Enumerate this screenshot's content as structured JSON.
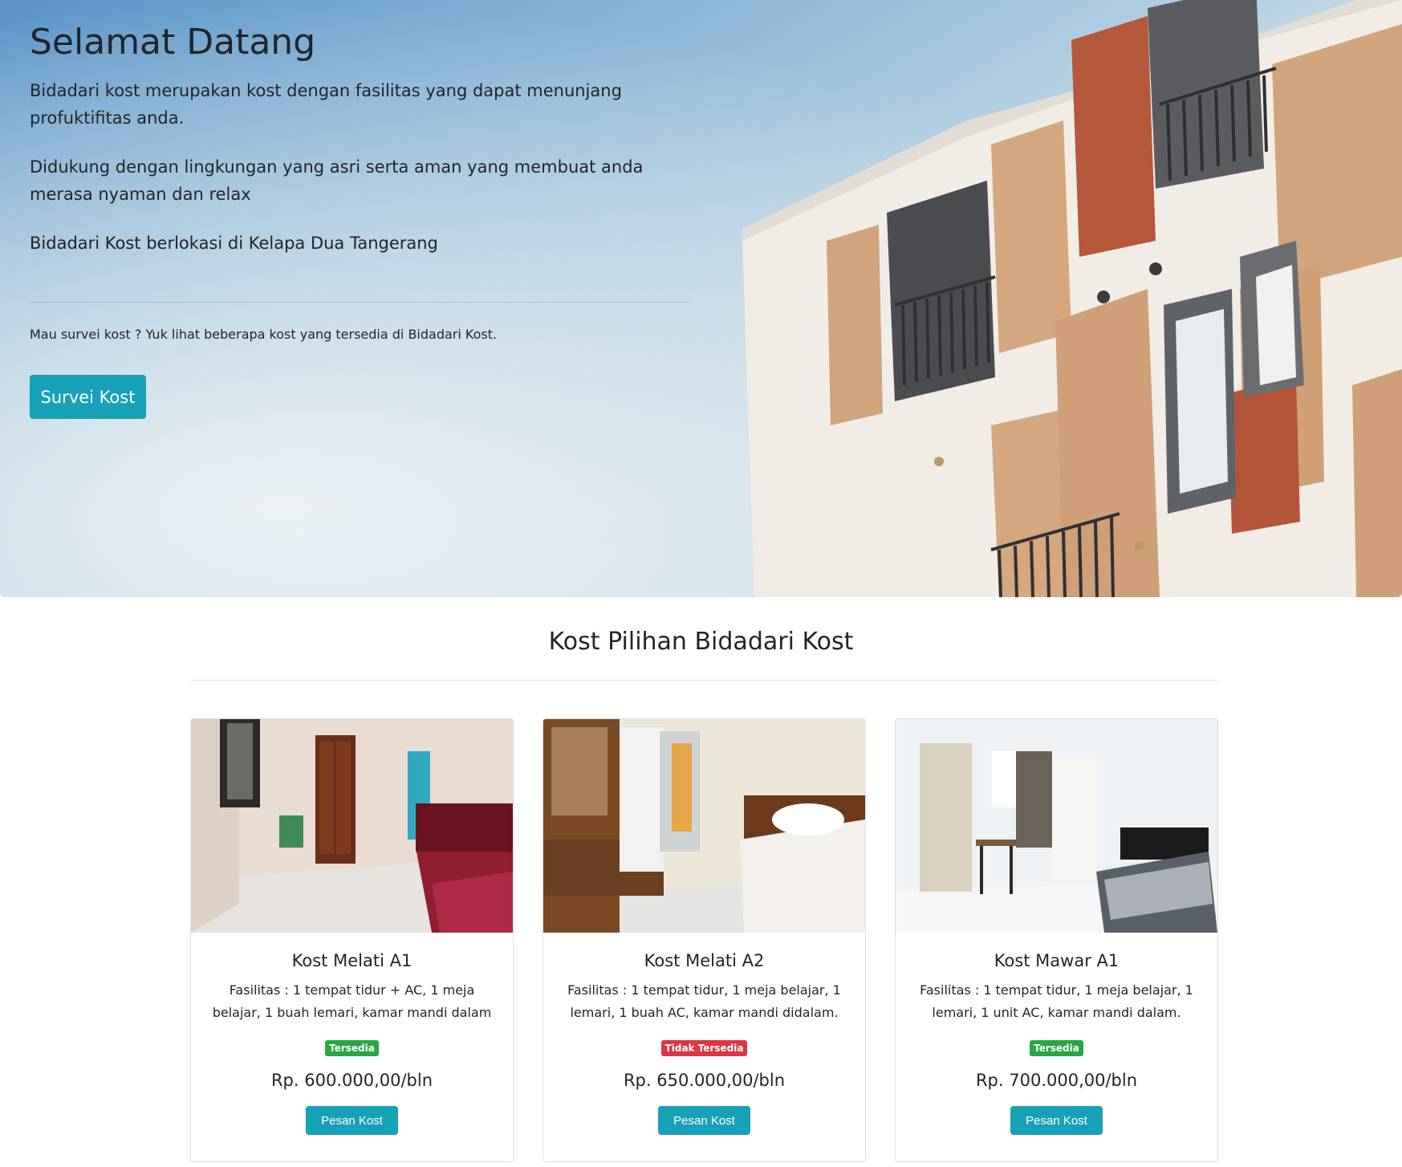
{
  "hero": {
    "title": "Selamat Datang",
    "paragraphs": [
      "Bidadari kost merupakan kost dengan fasilitas yang dapat menunjang profuktifitas anda.",
      "Didukung dengan lingkungan yang asri serta aman yang membuat anda merasa nyaman dan relax",
      "Bidadari Kost berlokasi di Kelapa Dua Tangerang"
    ],
    "small_text": "Mau survei kost ? Yuk lihat beberapa kost yang tersedia di Bidadari Kost.",
    "button_label": "Survei Kost"
  },
  "section": {
    "title": "Kost Pilihan Bidadari Kost"
  },
  "cards": [
    {
      "title": "Kost Melati A1",
      "facilities": "Fasilitas : 1 tempat tidur + AC, 1 meja belajar, 1 buah lemari, kamar mandi dalam",
      "status": "Tersedia",
      "price": "Rp. 600.000,00/bln",
      "button_label": "Pesan Kost"
    },
    {
      "title": "Kost Melati A2",
      "facilities": "Fasilitas : 1 tempat tidur, 1 meja belajar, 1 lemari, 1 buah AC, kamar mandi didalam.",
      "status": "Tidak Tersedia",
      "price": "Rp. 650.000,00/bln",
      "button_label": "Pesan Kost"
    },
    {
      "title": "Kost Mawar A1",
      "facilities": "Fasilitas : 1 tempat tidur, 1 meja belajar, 1 lemari, 1 unit AC, kamar mandi dalam.",
      "status": "Tersedia",
      "price": "Rp. 700.000,00/bln",
      "button_label": "Pesan Kost"
    }
  ],
  "colors": {
    "primary_button": "#17a2b8",
    "badge_available": "#28a745",
    "badge_unavailable": "#dc3545"
  }
}
